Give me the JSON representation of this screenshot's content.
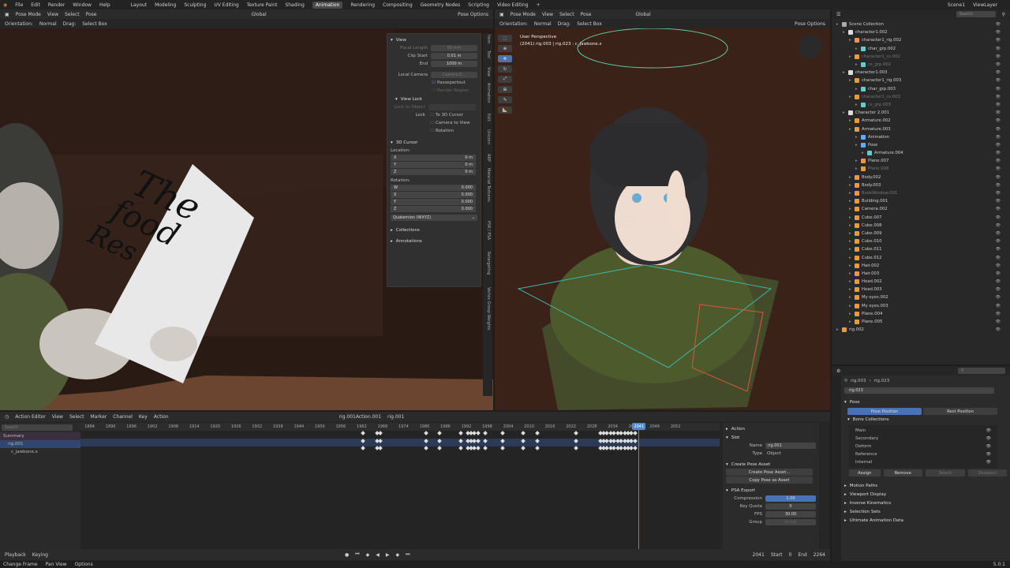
{
  "menu": {
    "items": [
      "File",
      "Edit",
      "Render",
      "Window",
      "Help"
    ],
    "workspaces": [
      "Layout",
      "Modeling",
      "Sculpting",
      "UV Editing",
      "Texture Paint",
      "Shading",
      "Animation",
      "Rendering",
      "Compositing",
      "Geometry Nodes",
      "Scripting",
      "Video Editing"
    ],
    "active_workspace": "Animation",
    "scene": "Scene1",
    "view_layer": "ViewLayer"
  },
  "vp1": {
    "mode": "Pose Mode",
    "menus": [
      "View",
      "Select",
      "Pose"
    ],
    "orientation_label": "Orientation:",
    "orientation": "Normal",
    "drag_label": "Drag:",
    "drag": "Select Box",
    "transform": "Global",
    "pose_options": "Pose Options"
  },
  "npanel": {
    "view_header": "View",
    "focal_length_label": "Focal Length",
    "focal_length": "50 mm",
    "clip_start_label": "Clip Start",
    "clip_start": "0.01 m",
    "end_label": "End",
    "clip_end": "1000 m",
    "local_camera_label": "Local Camera",
    "local_camera": "Camera.0...",
    "passepartout": "Passepartout",
    "render_region": "Render Region",
    "view_lock_header": "View Lock",
    "lock_to_object": "Lock to Object",
    "lock_label": "Lock",
    "to_3d_cursor": "To 3D Cursor",
    "camera_to_view": "Camera to View",
    "rotation_lock": "Rotation",
    "cursor_header": "3D Cursor",
    "location_label": "Location:",
    "loc": [
      {
        "axis": "X",
        "val": "0 m"
      },
      {
        "axis": "Y",
        "val": "0 m"
      },
      {
        "axis": "Z",
        "val": "0 m"
      }
    ],
    "rotation_label": "Rotation:",
    "rot": [
      {
        "axis": "W",
        "val": "0.000"
      },
      {
        "axis": "X",
        "val": "0.000"
      },
      {
        "axis": "Y",
        "val": "0.000"
      },
      {
        "axis": "Z",
        "val": "0.000"
      }
    ],
    "rot_mode": "Quaternion (WXYZ)",
    "collections": "Collections",
    "annotations": "Annotations",
    "tabs": [
      "Item",
      "Tool",
      "View",
      "Animation",
      "Edit",
      "Unicorn",
      "ARP",
      "Material Textures",
      "PSK / PSA",
      "Retargeting",
      "Vertex Group Weights"
    ]
  },
  "note": {
    "lines": [
      "The",
      "food",
      "Res"
    ]
  },
  "vp2": {
    "mode": "Pose Mode",
    "menus": [
      "View",
      "Select",
      "Pose"
    ],
    "orientation_label": "Orientation:",
    "orientation": "Normal",
    "drag_label": "Drag:",
    "drag": "Select Box",
    "transform": "Global",
    "pose_options": "Pose Options",
    "overlay_title": "User Perspective",
    "overlay_sub": "(2041) rig.003 | rig.023 : c_jawbone.x"
  },
  "outliner": {
    "search_placeholder": "Search",
    "items": [
      {
        "label": "Scene Collection",
        "indent": 0,
        "dim": false,
        "color": "#aaa"
      },
      {
        "label": "character1.002",
        "indent": 1,
        "dim": false,
        "color": "#ddd"
      },
      {
        "label": "character1_rig.002",
        "indent": 2,
        "dim": false,
        "color": "#e89a3c"
      },
      {
        "label": "char_grp.002",
        "indent": 3,
        "dim": false,
        "color": "#6cc"
      },
      {
        "label": "character1_cs.002",
        "indent": 2,
        "dim": true,
        "color": "#e89a3c"
      },
      {
        "label": "cs_grp.002",
        "indent": 3,
        "dim": true,
        "color": "#6cc"
      },
      {
        "label": "character1.003",
        "indent": 1,
        "dim": false,
        "color": "#ddd"
      },
      {
        "label": "character1_rig.003",
        "indent": 2,
        "dim": false,
        "color": "#e89a3c"
      },
      {
        "label": "char_grp.003",
        "indent": 3,
        "dim": false,
        "color": "#6cc"
      },
      {
        "label": "character1_cs.003",
        "indent": 2,
        "dim": true,
        "color": "#e89a3c"
      },
      {
        "label": "cs_grp.003",
        "indent": 3,
        "dim": true,
        "color": "#6cc"
      },
      {
        "label": "Character 2.001",
        "indent": 1,
        "dim": false,
        "color": "#ddd"
      },
      {
        "label": "Armature.002",
        "indent": 2,
        "dim": false,
        "color": "#e89a3c"
      },
      {
        "label": "Armature.003",
        "indent": 2,
        "dim": false,
        "color": "#e89a3c"
      },
      {
        "label": "Animation",
        "indent": 3,
        "dim": false,
        "color": "#6af"
      },
      {
        "label": "Pose",
        "indent": 3,
        "dim": false,
        "color": "#6af"
      },
      {
        "label": "Armature.004",
        "indent": 4,
        "dim": false,
        "color": "#6cc"
      },
      {
        "label": "Plane.007",
        "indent": 3,
        "dim": false,
        "color": "#e89a3c"
      },
      {
        "label": "Plane.008",
        "indent": 3,
        "dim": true,
        "color": "#e89a3c"
      },
      {
        "label": "Body.002",
        "indent": 2,
        "dim": false,
        "color": "#e89a3c"
      },
      {
        "label": "Body.003",
        "indent": 2,
        "dim": false,
        "color": "#e89a3c"
      },
      {
        "label": "BookWindow.001",
        "indent": 2,
        "dim": true,
        "color": "#e89a3c"
      },
      {
        "label": "Building.001",
        "indent": 2,
        "dim": false,
        "color": "#e89a3c"
      },
      {
        "label": "Camera.002",
        "indent": 2,
        "dim": false,
        "color": "#e89a3c"
      },
      {
        "label": "Cube.007",
        "indent": 2,
        "dim": false,
        "color": "#e89a3c"
      },
      {
        "label": "Cube.008",
        "indent": 2,
        "dim": false,
        "color": "#e89a3c"
      },
      {
        "label": "Cube.009",
        "indent": 2,
        "dim": false,
        "color": "#e89a3c"
      },
      {
        "label": "Cube.010",
        "indent": 2,
        "dim": false,
        "color": "#e89a3c"
      },
      {
        "label": "Cube.011",
        "indent": 2,
        "dim": false,
        "color": "#e89a3c"
      },
      {
        "label": "Cube.012",
        "indent": 2,
        "dim": false,
        "color": "#e89a3c"
      },
      {
        "label": "Hair.002",
        "indent": 2,
        "dim": false,
        "color": "#e89a3c"
      },
      {
        "label": "Hair.003",
        "indent": 2,
        "dim": false,
        "color": "#e89a3c"
      },
      {
        "label": "Head.002",
        "indent": 2,
        "dim": false,
        "color": "#e89a3c"
      },
      {
        "label": "Head.003",
        "indent": 2,
        "dim": false,
        "color": "#e89a3c"
      },
      {
        "label": "My eyes.002",
        "indent": 2,
        "dim": false,
        "color": "#e89a3c"
      },
      {
        "label": "My eyes.003",
        "indent": 2,
        "dim": false,
        "color": "#e89a3c"
      },
      {
        "label": "Plane.004",
        "indent": 2,
        "dim": false,
        "color": "#e89a3c"
      },
      {
        "label": "Plane.005",
        "indent": 2,
        "dim": false,
        "color": "#e89a3c"
      },
      {
        "label": "rig.002",
        "indent": 0,
        "dim": false,
        "color": "#e89a3c"
      }
    ]
  },
  "props": {
    "breadcrumb": [
      "rig.003",
      "rig.023"
    ],
    "bone_name": "rig.023",
    "pose_header": "Pose",
    "pose_position": "Pose Position",
    "rest_position": "Rest Position",
    "bone_collections": "Bone Collections",
    "collections": [
      "Main",
      "Secondary",
      "Deform",
      "Reference",
      "Internal"
    ],
    "assign": "Assign",
    "remove": "Remove",
    "select": "Select",
    "deselect": "Deselect",
    "sections": [
      "Motion Paths",
      "Viewport Display",
      "Inverse Kinematics",
      "Selection Sets",
      "Ultimate Animation Data"
    ]
  },
  "timeline": {
    "editor": "Action Editor",
    "menus": [
      "View",
      "Select",
      "Marker",
      "Channel",
      "Key",
      "Action"
    ],
    "action_name": "rig.001Action.001",
    "slot_name": "rig.001",
    "search_placeholder": "Search",
    "channels": [
      "Summary",
      "rig.001",
      "c_jawbone.x"
    ],
    "ruler": [
      "1884",
      "1890",
      "1896",
      "1902",
      "1908",
      "1914",
      "1920",
      "1926",
      "1932",
      "1938",
      "1944",
      "1950",
      "1956",
      "1962",
      "1968",
      "1974",
      "1980",
      "1986",
      "1992",
      "1998",
      "2004",
      "2010",
      "2016",
      "2022",
      "2028",
      "2034",
      "2040",
      "2046",
      "2052"
    ],
    "current_frame": "2041",
    "key_frames": [
      1962,
      1966,
      1967,
      1980,
      1984,
      1990,
      1992,
      1993,
      1994,
      1995,
      1997,
      2002,
      2008,
      2012,
      2023,
      2030,
      2031,
      2032,
      2033,
      2034,
      2035,
      2036,
      2037,
      2038,
      2039,
      2040
    ],
    "playback": "Playback",
    "keying": "Keying",
    "action": "Action",
    "start_label": "Start",
    "start": "0",
    "end_label": "End",
    "end": "2264",
    "frame_readout": "2041",
    "side": {
      "action_header": "Action",
      "slot_header": "Slot",
      "name_label": "Name",
      "name": "rig.001",
      "type_label": "Type",
      "type": "Object",
      "create_pose_asset_header": "Create Pose Asset",
      "create_pose_asset": "Create Pose Asset...",
      "copy_pose_as_asset": "Copy Pose as Asset",
      "psa_header": "PSA Export",
      "compression_label": "Compression",
      "compression": "1.00",
      "key_quota_label": "Key Quota",
      "key_quota": "0",
      "fps_label": "FPS",
      "fps": "30.00",
      "group_label": "Group",
      "group": "Group"
    }
  },
  "status": {
    "items": [
      "Change Frame",
      "Pan View",
      "Options"
    ],
    "version": "5.0.1"
  }
}
